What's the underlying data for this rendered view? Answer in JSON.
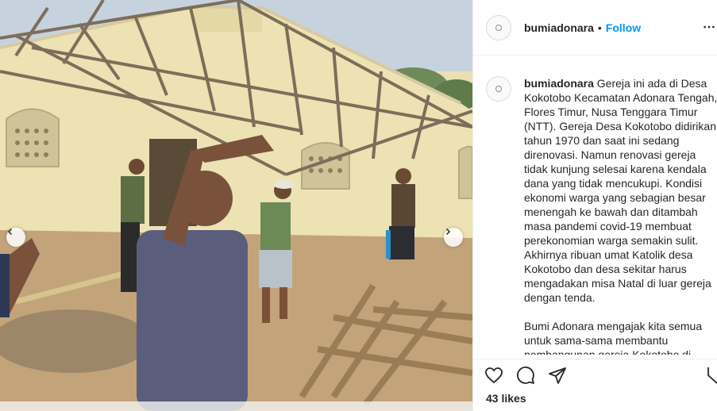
{
  "post": {
    "username": "bumiadonara",
    "separator": "•",
    "follow_label": "Follow",
    "more_icon": "ellipsis-icon",
    "caption_paragraphs": [
      "Gereja ini ada di Desa Kokotobo Kecamatan Adonara Tengah, Flores Timur, Nusa Tenggara Timur (NTT). Gereja Desa Kokotobo didirikan tahun 1970 dan saat ini sedang direnovasi. Namun renovasi gereja tidak kunjung selesai karena kendala dana yang tidak mencukupi. Kondisi ekonomi warga yang sebagian besar menengah ke bawah dan ditambah masa pandemi covid-19 membuat perekonomian warga semakin sulit. Akhirnya ribuan umat Katolik desa Kokotobo dan desa sekitar harus mengadakan misa Natal di luar gereja dengan tenda.",
      "Bumi Adonara mengajak kita semua untuk sama-sama membantu pembangunan gereja Kokotobo di"
    ],
    "likes_text": "43 likes"
  },
  "media": {
    "prev_icon": "chevron-left-icon",
    "next_icon": "chevron-right-icon"
  },
  "actions": {
    "like_icon": "heart-icon",
    "comment_icon": "comment-icon",
    "share_icon": "paper-plane-icon",
    "save_icon": "bookmark-icon"
  },
  "colors": {
    "accent": "#0095f6",
    "text": "#262626",
    "border": "#efefef"
  }
}
